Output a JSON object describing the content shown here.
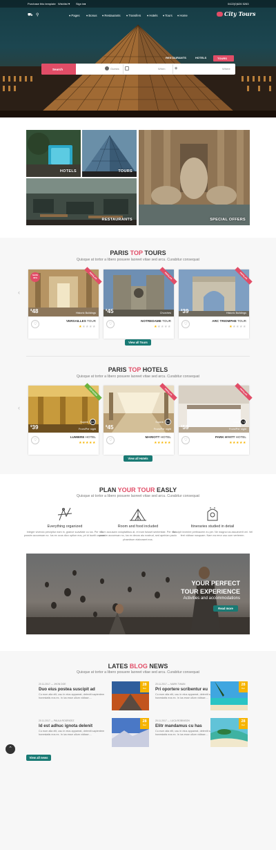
{
  "topbar": {
    "purchase": "Purchase this template",
    "wishlist": "Wishlist",
    "signin": "Sign in",
    "phone": "0422(0)626 5263"
  },
  "nav": {
    "items": [
      "Pages",
      "Bonus",
      "Restaurants",
      "Transfers",
      "Hotels",
      "Tours",
      "Home"
    ]
  },
  "logo": {
    "text": "City Tours"
  },
  "search": {
    "tabs": [
      "RESTAURANTS",
      "HOTELS",
      "TOURS"
    ],
    "active_tab": "TOURS",
    "button": "Search",
    "guests": "Guests",
    "when": "When",
    "where": "Where"
  },
  "tiles": {
    "hotels": "HOTELS",
    "tours": "TOURS",
    "restaurants": "RESTAURANTS",
    "special_offers": "SPECIAL OFFERS"
  },
  "tours_section": {
    "title_a": "PARIS ",
    "title_hl": "TOP",
    "title_b": " TOURS",
    "subtitle": "Quisque at tortor a libero posuere laoreet vitae sed arcu. Curabitur consequat",
    "cards": [
      {
        "price": "48",
        "currency": "$",
        "caption": "Historic Buildings",
        "name": "VERSAILLES",
        "suffix": "TOUR",
        "rating": 1,
        "badge": "SAVE 30%"
      },
      {
        "price": "45",
        "currency": "$",
        "caption": "Churches",
        "name": "NOTREDAME",
        "suffix": "TOUR",
        "rating": 1
      },
      {
        "price": "39",
        "currency": "$",
        "caption": "Historic Buildings",
        "name": "ARC TRIOMPHE",
        "suffix": "TOUR",
        "rating": 1
      }
    ],
    "button": "View all Tours"
  },
  "hotels_section": {
    "title_a": "PARIS ",
    "title_hl": "TOP",
    "title_b": " HOTELS",
    "subtitle": "Quisque at tortor a libero posuere laoreet vitae sed arcu. Curabitur consequat",
    "cards": [
      {
        "price": "39",
        "currency": "$",
        "caption": "From/Per night",
        "name": "LUMIERE",
        "suffix": "HOTEL",
        "score": "8.5",
        "score_label": "Superb",
        "rating": 5
      },
      {
        "price": "45",
        "currency": "$",
        "caption": "From/Per night",
        "name": "MARIOTT",
        "suffix": "HOTEL",
        "score": "9.0",
        "score_label": "Superb",
        "rating": 5
      },
      {
        "price": "59",
        "currency": "$",
        "caption": "From/Per night",
        "name": "PARK HYATT",
        "suffix": "HOTEL",
        "score": "7.5",
        "score_label": "Good",
        "rating": 5
      }
    ],
    "button": "View all Hotels"
  },
  "plan_section": {
    "title_a": "PLAN ",
    "title_hl": "YOUR TOUR",
    "title_b": " EASLY",
    "subtitle": "Quisque at tortor a libero posuere laoreet vitae sed arcu. Curabitur consequat",
    "features": [
      {
        "icon": "route-icon",
        "title": "Everything organized",
        "desc": "Integre vivendo percipitur eam in, graece suavitate cu ius. Per nisl possim accumsan no. Ius ex ocus dico option eos, pri id lauriti causae."
      },
      {
        "icon": "tent-icon",
        "title": "Room and food included",
        "desc": "Cum accusam voluptatibus at, et eum fuisset sententiae. Per nisl possim accumsan no, ius ex decus aiu nostrud, sed apeirian paulo phaedrum elaboraret eos."
      },
      {
        "icon": "map-icon",
        "title": "Itineraries studied in detail",
        "desc": "Suscipit invenire pertinacem eu per. Ne magna ius assueverit vel. Vel ferri vidisse nusquam. Nam ea error usu cum verterem."
      }
    ],
    "banner_title_1": "YOUR PERFECT",
    "banner_title_2": "TOUR EXPERIENCE",
    "banner_sub": "Activities and accommodations",
    "banner_button": "Read more"
  },
  "blog_section": {
    "title_a": "LATES ",
    "title_hl": "BLOG",
    "title_b": " NEWS",
    "subtitle": "Quisque at tortor a libero posuere laoreet vitae sed arcu. Curabitur consequat",
    "posts": [
      {
        "meta": "20.11.2017   —   JHON DOE",
        "title": "Duo eius postea suscipit ad",
        "desc": "Cu eum alia elit, usu in eius appareat, deleniti sapientem honestatis eos ex. In ius esse ullum vidisse....",
        "day": "28",
        "month": "Dec"
      },
      {
        "meta": "20.11.2017   —   MARK TWAIN",
        "title": "Pri oportere scribentur eu",
        "desc": "Cu eum alia elit, usu in eius appareat, deleniti sapientem honestatis eos ex. In ius esse ullum vidisse....",
        "day": "28",
        "month": "Dec"
      },
      {
        "meta": "20.11.2017   —   PAULA RODRIGEZ",
        "title": "Id est adhuc ignota delenit",
        "desc": "Cu eum alia elit, usu in eius appareat, deleniti sapientem honestatis eos ex. In ius esse ullum vidisse....",
        "day": "28",
        "month": "Dec"
      },
      {
        "meta": "20.11.2017   —   LUCA ROBINSON",
        "title": "Elitr mandamus cu has",
        "desc": "Cu eum alia elit, usu in eius appareat, deleniti sapientem honestatis eos ex. In ius esse ullum vidisse....",
        "day": "28",
        "month": "Dec"
      }
    ],
    "button": "View all news"
  },
  "colors": {
    "accent": "#e14d67",
    "teal": "#197a74",
    "star": "#f6b400"
  }
}
